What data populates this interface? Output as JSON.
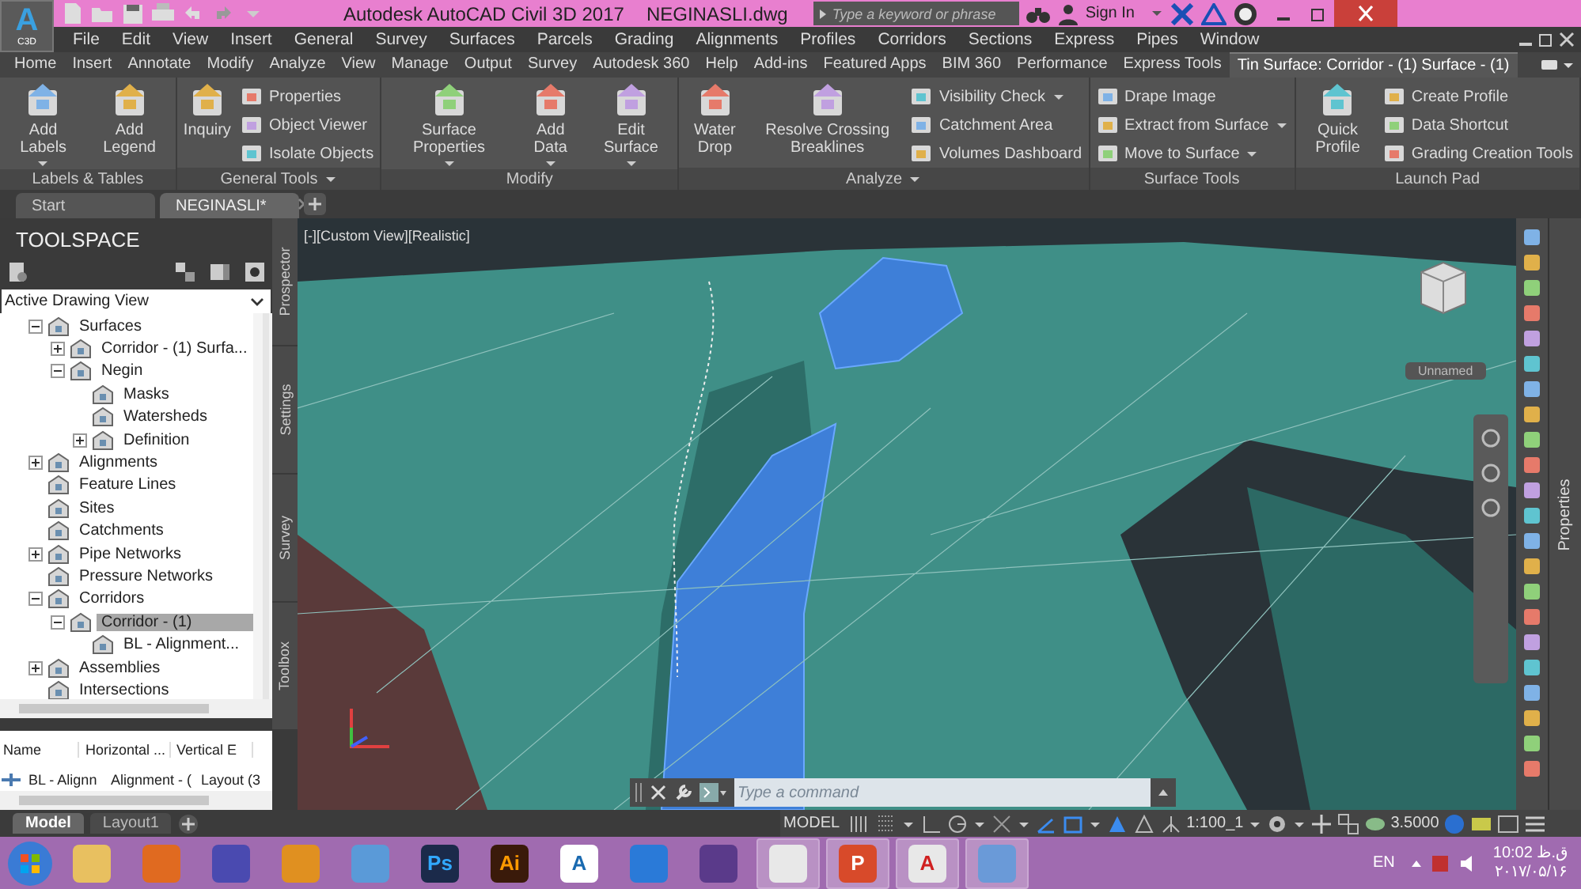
{
  "window": {
    "app_button": {
      "letter": "A",
      "badge": "C3D"
    },
    "title": "Autodesk AutoCAD Civil 3D 2017",
    "file": "NEGINASLI.dwg",
    "search": {
      "placeholder": "Type a keyword or phrase"
    },
    "sign_in": "Sign In"
  },
  "menu": [
    "File",
    "Edit",
    "View",
    "Insert",
    "General",
    "Survey",
    "Surfaces",
    "Parcels",
    "Grading",
    "Alignments",
    "Profiles",
    "Corridors",
    "Sections",
    "Express",
    "Pipes",
    "Window"
  ],
  "ribbon_tabs": [
    {
      "label": "Home",
      "selected": false
    },
    {
      "label": "Insert",
      "selected": false
    },
    {
      "label": "Annotate",
      "selected": false
    },
    {
      "label": "Modify",
      "selected": false
    },
    {
      "label": "Analyze",
      "selected": false
    },
    {
      "label": "View",
      "selected": false
    },
    {
      "label": "Manage",
      "selected": false
    },
    {
      "label": "Output",
      "selected": false
    },
    {
      "label": "Survey",
      "selected": false
    },
    {
      "label": "Autodesk 360",
      "selected": false
    },
    {
      "label": "Help",
      "selected": false
    },
    {
      "label": "Add-ins",
      "selected": false
    },
    {
      "label": "Featured Apps",
      "selected": false
    },
    {
      "label": "BIM 360",
      "selected": false
    },
    {
      "label": "Performance",
      "selected": false
    },
    {
      "label": "Express Tools",
      "selected": false
    },
    {
      "label": "Tin Surface: Corridor - (1) Surface - (1)",
      "selected": true
    }
  ],
  "ribbon_panels": [
    {
      "title": "Labels & Tables",
      "menu": false,
      "large": [
        {
          "label": "Add Labels",
          "dropdown": true
        },
        {
          "label": "Add Legend",
          "dropdown": false
        }
      ]
    },
    {
      "title": "General Tools",
      "menu": true,
      "large": [
        {
          "label": "Inquiry",
          "dropdown": false
        }
      ],
      "small": [
        {
          "label": "Properties",
          "dropdown": false
        },
        {
          "label": "Object Viewer",
          "dropdown": false
        },
        {
          "label": "Isolate Objects",
          "dropdown": false
        }
      ]
    },
    {
      "title": "Modify",
      "menu": false,
      "large": [
        {
          "label": "Surface Properties",
          "dropdown": true
        },
        {
          "label": "Add Data",
          "dropdown": true
        },
        {
          "label": "Edit Surface",
          "dropdown": true
        }
      ]
    },
    {
      "title": "Analyze",
      "menu": true,
      "large": [
        {
          "label": "Water Drop",
          "dropdown": false
        },
        {
          "label": "Resolve Crossing Breaklines",
          "dropdown": false
        }
      ],
      "small": [
        {
          "label": "Visibility Check",
          "dropdown": true
        },
        {
          "label": "Catchment Area",
          "dropdown": false
        },
        {
          "label": "Volumes Dashboard",
          "dropdown": false
        }
      ]
    },
    {
      "title": "Surface Tools",
      "menu": false,
      "small": [
        {
          "label": "Drape Image",
          "dropdown": false
        },
        {
          "label": "Extract from Surface",
          "dropdown": true
        },
        {
          "label": "Move to Surface",
          "dropdown": true
        }
      ]
    },
    {
      "title": "Launch Pad",
      "menu": false,
      "large": [
        {
          "label": "Quick Profile",
          "dropdown": false
        }
      ],
      "small": [
        {
          "label": "Create Profile",
          "dropdown": false
        },
        {
          "label": "Data Shortcut",
          "dropdown": false
        },
        {
          "label": "Grading Creation Tools",
          "dropdown": false
        }
      ]
    }
  ],
  "doc_tabs": [
    {
      "label": "Start",
      "selected": false
    },
    {
      "label": "NEGINASLI*",
      "selected": true
    }
  ],
  "toolspace": {
    "title": "TOOLSPACE",
    "view": "Active Drawing View",
    "tree": [
      {
        "label": "Surfaces",
        "expanded": true,
        "selected": false,
        "children": [
          {
            "label": "Corridor - (1) Surfa...",
            "expanded": false,
            "selected": false
          },
          {
            "label": "Negin",
            "expanded": true,
            "selected": false,
            "children": [
              {
                "label": "Masks",
                "selected": false
              },
              {
                "label": "Watersheds",
                "selected": false
              },
              {
                "label": "Definition",
                "expanded": false,
                "selected": false
              }
            ]
          }
        ]
      },
      {
        "label": "Alignments",
        "expanded": false,
        "selected": false
      },
      {
        "label": "Feature Lines",
        "selected": false
      },
      {
        "label": "Sites",
        "selected": false
      },
      {
        "label": "Catchments",
        "selected": false
      },
      {
        "label": "Pipe Networks",
        "expanded": false,
        "selected": false
      },
      {
        "label": "Pressure Networks",
        "selected": false
      },
      {
        "label": "Corridors",
        "expanded": true,
        "selected": false,
        "children": [
          {
            "label": "Corridor - (1)",
            "expanded": true,
            "selected": true,
            "children": [
              {
                "label": "BL - Alignment...",
                "selected": false
              }
            ]
          }
        ]
      },
      {
        "label": "Assemblies",
        "expanded": false,
        "selected": false
      },
      {
        "label": "Intersections",
        "selected": false
      }
    ],
    "list": {
      "columns": [
        "Name",
        "Horizontal ...",
        "Vertical E"
      ],
      "rows": [
        [
          "BL - Alignn",
          "Alignment - (",
          "Layout (3"
        ]
      ]
    },
    "side_tabs": [
      "Prospector",
      "Settings",
      "Survey",
      "Toolbox"
    ]
  },
  "viewport": {
    "label": "[-][Custom View][Realistic]",
    "view_name": "Unnamed",
    "command": {
      "placeholder": "Type a command"
    }
  },
  "properties_tab": "Properties",
  "layout_tabs": [
    {
      "label": "Model",
      "selected": true
    },
    {
      "label": "Layout1",
      "selected": false
    }
  ],
  "status_bar": {
    "mode": "MODEL",
    "scale": "1:100_1",
    "value": "3.5000"
  },
  "taskbar": {
    "apps": [
      {
        "running": false
      },
      {
        "running": false
      },
      {
        "running": false
      },
      {
        "running": false
      },
      {
        "running": false
      },
      {
        "label": "Ps",
        "running": false
      },
      {
        "label": "Ai",
        "running": false
      },
      {
        "label": "A",
        "running": false
      },
      {
        "running": false
      },
      {
        "running": false
      },
      {
        "running": true
      },
      {
        "label": "P",
        "running": true
      },
      {
        "label": "A",
        "running": true
      },
      {
        "running": true
      }
    ],
    "language": "EN",
    "time": "10:02 ق.ظ",
    "date": "۲۰۱۷/۰۵/۱۶"
  }
}
